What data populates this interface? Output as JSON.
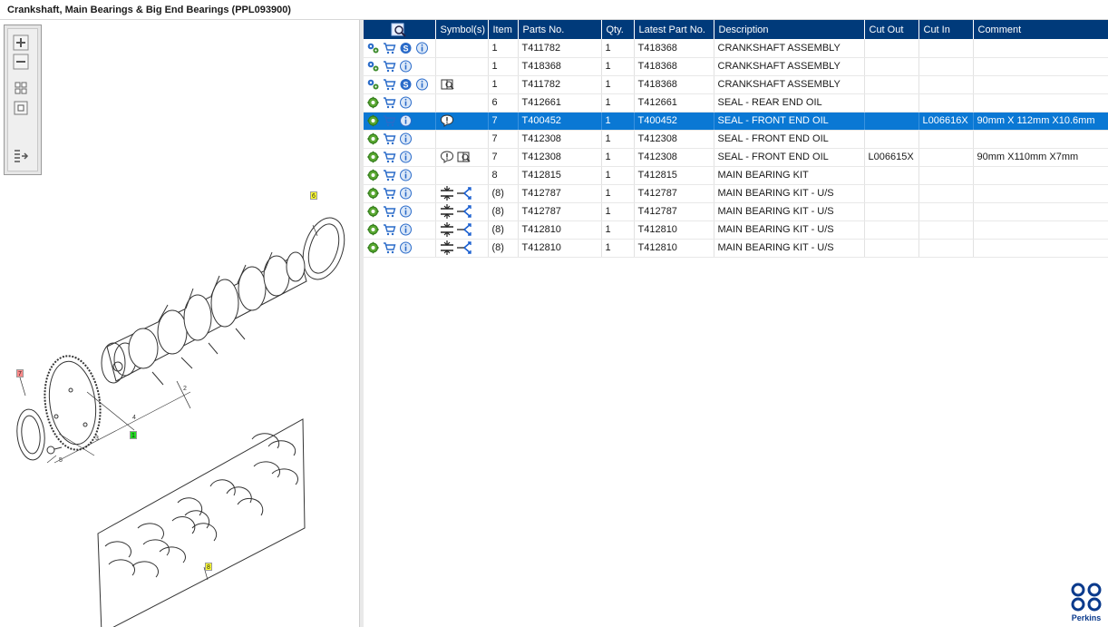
{
  "window": {
    "title": "Crankshaft, Main Bearings & Big End Bearings (PPL093900)"
  },
  "toolbox": {
    "tools": [
      {
        "name": "zoom-in"
      },
      {
        "name": "zoom-out"
      },
      {
        "name": "fit-grid"
      },
      {
        "name": "fit-window"
      },
      {
        "name": "toggle-list"
      }
    ]
  },
  "drawing": {
    "callouts": [
      {
        "label": "6",
        "style": "yellow"
      },
      {
        "label": "7",
        "style": "red"
      },
      {
        "label": "1",
        "style": "green"
      },
      {
        "label": "8",
        "style": "yellow"
      },
      {
        "label": "2",
        "style": "plain"
      },
      {
        "label": "3",
        "style": "plain"
      },
      {
        "label": "4",
        "style": "plain"
      },
      {
        "label": "5",
        "style": "plain"
      }
    ]
  },
  "table": {
    "headers": {
      "actions": "",
      "symbols": "Symbol(s)",
      "item": "Item",
      "parts_no": "Parts No.",
      "qty": "Qty.",
      "latest_part_no": "Latest Part No.",
      "description": "Description",
      "cut_out": "Cut Out",
      "cut_in": "Cut In",
      "comment": "Comment"
    },
    "rows": [
      {
        "actions": [
          "assembly-icon",
          "cart-icon",
          "service-icon",
          "info-icon"
        ],
        "symbols": [],
        "item": "1",
        "parts_no": "T411782",
        "qty": "1",
        "latest_part_no": "T418368",
        "description": "CRANKSHAFT ASSEMBLY",
        "cut_out": "",
        "cut_in": "",
        "comment": "",
        "selected": false
      },
      {
        "actions": [
          "assembly-icon",
          "cart-icon",
          "info-icon"
        ],
        "symbols": [],
        "item": "1",
        "parts_no": "T418368",
        "qty": "1",
        "latest_part_no": "T418368",
        "description": "CRANKSHAFT ASSEMBLY",
        "cut_out": "",
        "cut_in": "",
        "comment": "",
        "selected": false
      },
      {
        "actions": [
          "assembly-icon",
          "cart-icon",
          "service-icon",
          "info-icon"
        ],
        "symbols": [
          "book-magnifier-icon"
        ],
        "item": "1",
        "parts_no": "T411782",
        "qty": "1",
        "latest_part_no": "T418368",
        "description": "CRANKSHAFT ASSEMBLY",
        "cut_out": "",
        "cut_in": "",
        "comment": "",
        "selected": false
      },
      {
        "actions": [
          "gear-icon",
          "cart-icon",
          "info-icon"
        ],
        "symbols": [],
        "item": "6",
        "parts_no": "T412661",
        "qty": "1",
        "latest_part_no": "T412661",
        "description": "SEAL - REAR END OIL",
        "cut_out": "",
        "cut_in": "",
        "comment": "",
        "selected": false
      },
      {
        "actions": [
          "gear-icon",
          "cart-icon",
          "info-icon"
        ],
        "symbols": [
          "comment-alert-icon"
        ],
        "item": "7",
        "parts_no": "T400452",
        "qty": "1",
        "latest_part_no": "T400452",
        "description": "SEAL - FRONT END OIL",
        "cut_out": "",
        "cut_in": "L006616X",
        "comment": "90mm X 112mm X10.6mm",
        "selected": true
      },
      {
        "actions": [
          "gear-icon",
          "cart-icon",
          "info-icon"
        ],
        "symbols": [],
        "item": "7",
        "parts_no": "T412308",
        "qty": "1",
        "latest_part_no": "T412308",
        "description": "SEAL - FRONT END OIL",
        "cut_out": "",
        "cut_in": "",
        "comment": "",
        "selected": false
      },
      {
        "actions": [
          "gear-icon",
          "cart-icon",
          "info-icon"
        ],
        "symbols": [
          "comment-alert-icon",
          "book-magnifier-icon"
        ],
        "item": "7",
        "parts_no": "T412308",
        "qty": "1",
        "latest_part_no": "T412308",
        "description": "SEAL - FRONT END OIL",
        "cut_out": "L006615X",
        "cut_in": "",
        "comment": "90mm X110mm X7mm",
        "selected": false
      },
      {
        "actions": [
          "gear-icon",
          "cart-icon",
          "info-icon"
        ],
        "symbols": [],
        "item": "8",
        "parts_no": "T412815",
        "qty": "1",
        "latest_part_no": "T412815",
        "description": "MAIN BEARING KIT",
        "cut_out": "",
        "cut_in": "",
        "comment": "",
        "selected": false
      },
      {
        "actions": [
          "gear-icon",
          "cart-icon",
          "info-icon"
        ],
        "symbols": [
          "undersize-icon",
          "alternative-arrow-icon"
        ],
        "item": "(8)",
        "parts_no": "T412787",
        "qty": "1",
        "latest_part_no": "T412787",
        "description": "MAIN BEARING KIT - U/S",
        "cut_out": "",
        "cut_in": "",
        "comment": "",
        "selected": false
      },
      {
        "actions": [
          "gear-icon",
          "cart-icon",
          "info-icon"
        ],
        "symbols": [
          "undersize-icon",
          "alternative-arrow-icon"
        ],
        "item": "(8)",
        "parts_no": "T412787",
        "qty": "1",
        "latest_part_no": "T412787",
        "description": "MAIN BEARING KIT - U/S",
        "cut_out": "",
        "cut_in": "",
        "comment": "",
        "selected": false
      },
      {
        "actions": [
          "gear-icon",
          "cart-icon",
          "info-icon"
        ],
        "symbols": [
          "undersize-icon",
          "alternative-arrow-icon"
        ],
        "item": "(8)",
        "parts_no": "T412810",
        "qty": "1",
        "latest_part_no": "T412810",
        "description": "MAIN BEARING KIT - U/S",
        "cut_out": "",
        "cut_in": "",
        "comment": "",
        "selected": false
      },
      {
        "actions": [
          "gear-icon",
          "cart-icon",
          "info-icon"
        ],
        "symbols": [
          "undersize-icon",
          "alternative-arrow-icon"
        ],
        "item": "(8)",
        "parts_no": "T412810",
        "qty": "1",
        "latest_part_no": "T412810",
        "description": "MAIN BEARING KIT - U/S",
        "cut_out": "",
        "cut_in": "",
        "comment": "",
        "selected": false
      }
    ]
  },
  "brand": {
    "name": "Perkins"
  },
  "colors": {
    "header_bg": "#003a7a",
    "selected_row": "#0a78d4",
    "brand_blue": "#0a3a8c"
  }
}
